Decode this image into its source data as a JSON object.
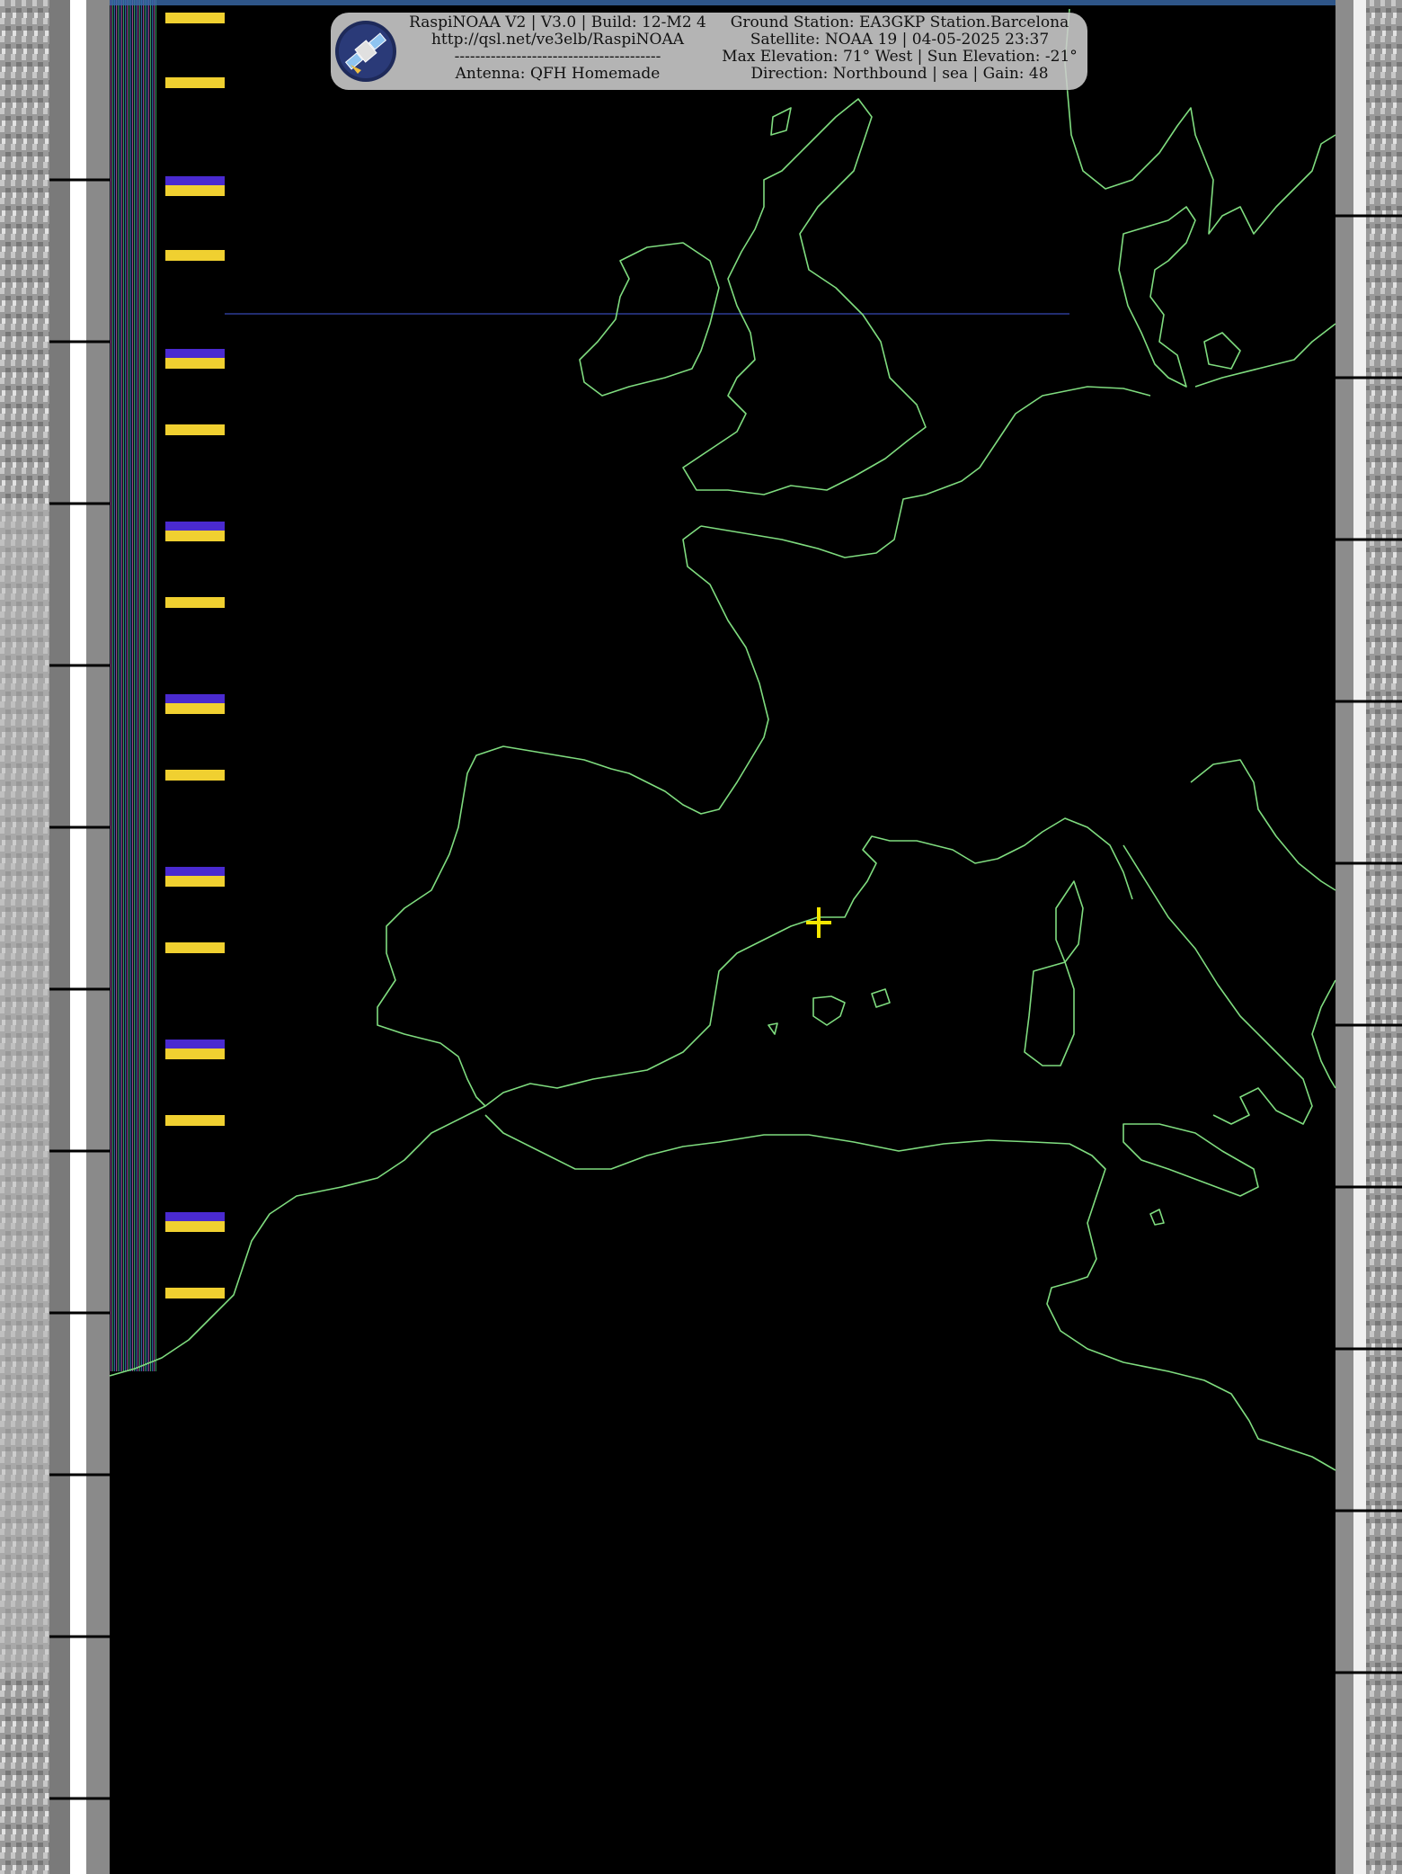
{
  "overlay": {
    "left": {
      "line1": "RaspiNOAA V2 | V3.0 | Build: 12-M2 4",
      "line2": "http://qsl.net/ve3elb/RaspiNOAA",
      "line3": "----------------------------------------",
      "line4": "Antenna: QFH Homemade"
    },
    "right": {
      "line1": "Ground Station: EA3GKP Station.Barcelona",
      "line2": "Satellite: NOAA 19 | 04-05-2025 23:37",
      "line3": "Max Elevation: 71° West | Sun Elevation: -21°",
      "line4": "Direction: Northbound | sea | Gain: 48"
    },
    "logo_icon": "satellite-logo-icon"
  },
  "colors": {
    "coastline": "#7fdc7f",
    "marker": "#f5e600",
    "background": "#000000",
    "panel": "#cdcdcd"
  }
}
